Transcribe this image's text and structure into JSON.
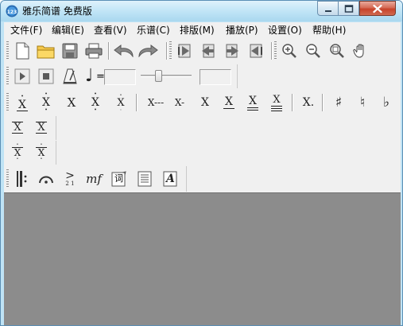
{
  "window": {
    "title": "雅乐简谱 免费版",
    "controls": {
      "minimize": "minimize",
      "maximize": "maximize",
      "close": "close"
    }
  },
  "menu": [
    {
      "label": "文件(F)"
    },
    {
      "label": "编辑(E)"
    },
    {
      "label": "查看(V)"
    },
    {
      "label": "乐谱(C)"
    },
    {
      "label": "排版(M)"
    },
    {
      "label": "播放(P)"
    },
    {
      "label": "设置(O)"
    },
    {
      "label": "帮助(H)"
    }
  ],
  "toolbar_file": [
    "new-file-icon",
    "open-folder-icon",
    "save-disk-icon",
    "print-icon",
    "undo-icon",
    "redo-icon"
  ],
  "toolbar_nav": [
    "first-page-icon",
    "previous-page-icon",
    "next-page-icon",
    "last-page-icon"
  ],
  "toolbar_view": [
    "zoom-in-icon",
    "zoom-out-icon",
    "zoom-fit-icon",
    "hand-pan-icon"
  ],
  "playback": {
    "tempo_symbol": "♩",
    "tempo_equals": "=",
    "tempo_value": "",
    "position_value": ""
  },
  "notes": {
    "glyph": "X",
    "dash_long": "X---",
    "dash_short": "X-",
    "dot_suffix": "X."
  },
  "accidentals": {
    "sharp": "♯",
    "natural": "♮",
    "flat": "♭"
  },
  "marks": {
    "cresc_top": ">",
    "cresc_bottom": "2 1",
    "dynamic": "mf",
    "lyrics": "词",
    "text": "A"
  },
  "colors": {
    "title_bar": "#c3e6f7",
    "toolbar_bg": "#f0f0f0",
    "canvas_bg": "#8c8c8c"
  }
}
